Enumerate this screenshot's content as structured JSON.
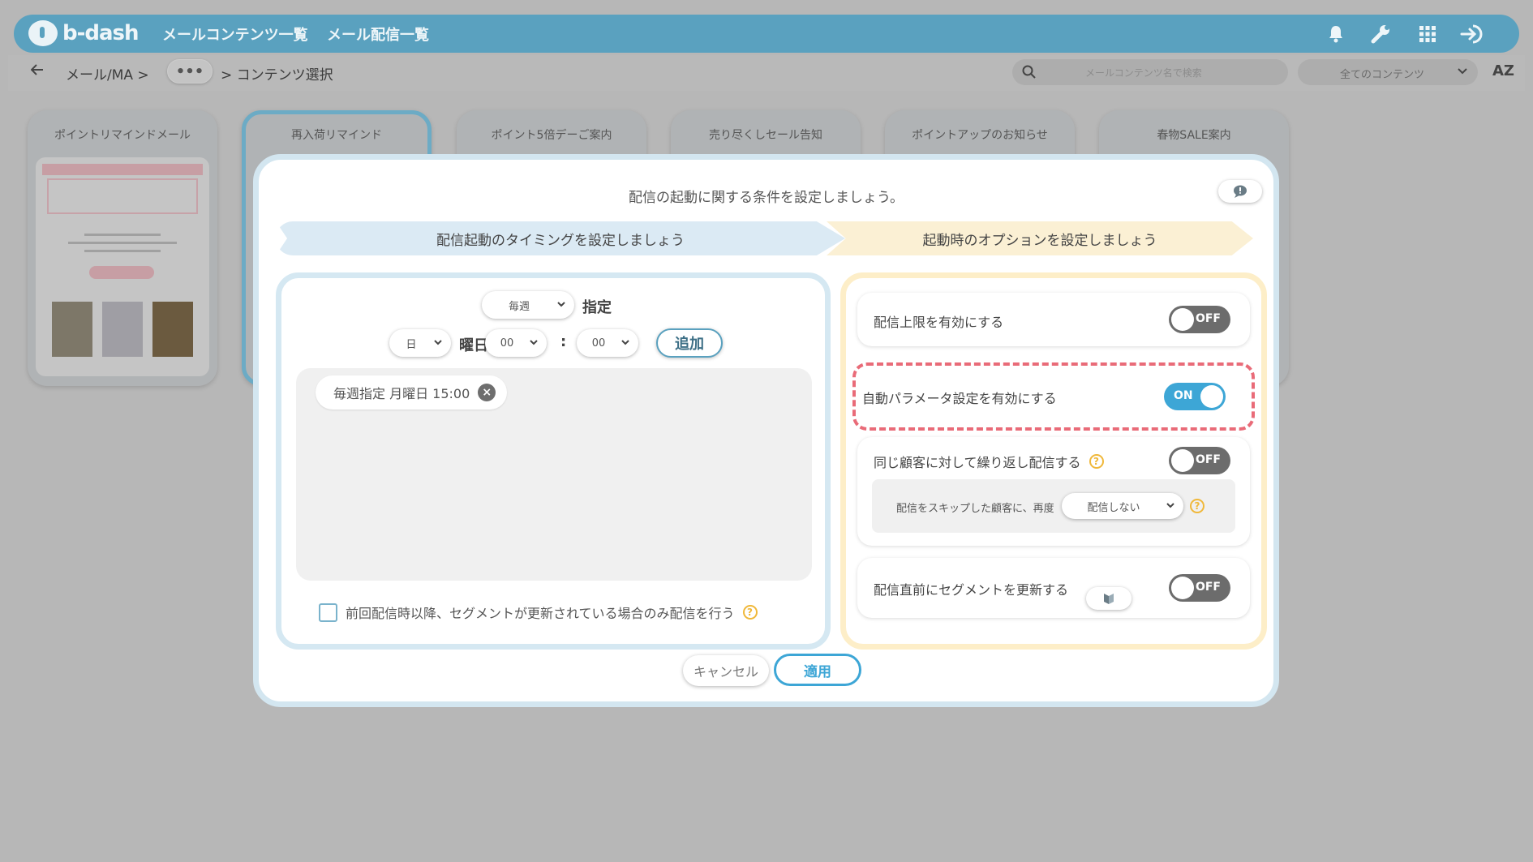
{
  "app": {
    "logo_text": "b-dash"
  },
  "header": {
    "nav": [
      "メールコンテンツ一覧",
      "メール配信一覧"
    ],
    "icons": [
      "bell-icon",
      "wrench-icon",
      "grid-icon",
      "logout-icon"
    ]
  },
  "breadcrumb": {
    "back_icon": "arrow-left-icon",
    "root": "メール/MA >",
    "more": "•••",
    "current": "> コンテンツ選択"
  },
  "search": {
    "placeholder": "メールコンテンツ名で検索"
  },
  "filter": {
    "selected": "全てのコンテンツ"
  },
  "sort": {
    "label": "AZ"
  },
  "cards": [
    {
      "title": "ポイントリマインドメール"
    },
    {
      "title": "再入荷リマインド"
    },
    {
      "title": "ポイント5倍デーご案内"
    },
    {
      "title": "売り尽くしセール告知"
    },
    {
      "title": "ポイントアップのお知らせ"
    },
    {
      "title": "春物SALE案内"
    }
  ],
  "modal": {
    "title": "配信の起動に関する条件を設定しましょう。",
    "steps": [
      "配信起動のタイミングを設定しましょう",
      "起動時のオプションを設定しましょう"
    ],
    "timing": {
      "frequency": "毎週",
      "frequency_suffix": "指定",
      "weekday": "日",
      "weekday_suffix": "曜日",
      "hour": "00",
      "colon": ":",
      "minute": "00",
      "add_label": "追加",
      "entries": [
        "毎週指定 月曜日 15:00"
      ],
      "checkbox_label": "前回配信時以降、セグメントが更新されている場合のみ配信を行う"
    },
    "options": {
      "limit": {
        "label": "配信上限を有効にする",
        "state": "OFF"
      },
      "auto_param": {
        "label": "自動パラメータ設定を有効にする",
        "state": "ON"
      },
      "repeat": {
        "label": "同じ顧客に対して繰り返し配信する",
        "state": "OFF",
        "sub_label": "配信をスキップした顧客に、再度",
        "sub_select": "配信しない"
      },
      "segment": {
        "label": "配信直前にセグメントを更新する",
        "state": "OFF"
      }
    },
    "cancel_label": "キャンセル",
    "apply_label": "適用"
  },
  "colors": {
    "header": "#5aa1bf",
    "accent": "#3da6d6",
    "highlight_dash": "#e96b78"
  }
}
